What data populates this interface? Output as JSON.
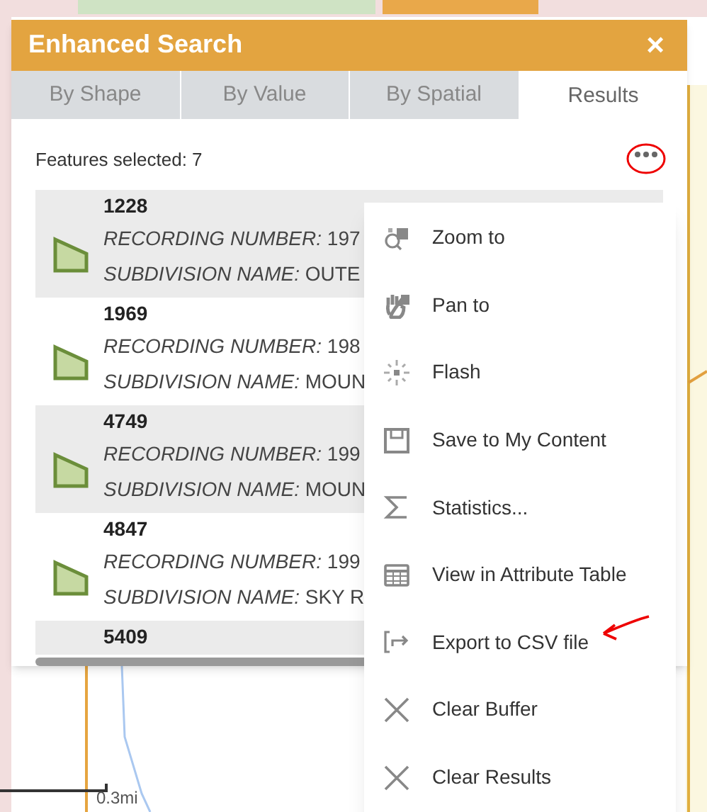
{
  "window": {
    "title": "Enhanced Search",
    "close": "×"
  },
  "tabs": [
    {
      "label": "By Shape",
      "selected": false
    },
    {
      "label": "By Value",
      "selected": false
    },
    {
      "label": "By Spatial",
      "selected": false
    },
    {
      "label": "Results",
      "selected": true
    }
  ],
  "summary": "Features selected: 7",
  "results": [
    {
      "title": "1228",
      "recording": "*RECORDING NUMBER:* 197",
      "subdivision": "*SUBDIVISION NAME:* OUTE"
    },
    {
      "title": "1969",
      "recording": "*RECORDING NUMBER:* 198",
      "subdivision": "*SUBDIVISION NAME:* MOUN"
    },
    {
      "title": "4749",
      "recording": "*RECORDING NUMBER:* 199",
      "subdivision": "*SUBDIVISION NAME:* MOUN"
    },
    {
      "title": "4847",
      "recording": "*RECORDING NUMBER:* 199",
      "subdivision": "*SUBDIVISION NAME:* SKY R"
    },
    {
      "title": "5409"
    }
  ],
  "menu": [
    {
      "label": "Zoom to",
      "kind": "zoom"
    },
    {
      "label": "Pan to",
      "kind": "pan"
    },
    {
      "label": "Flash",
      "kind": "flash"
    },
    {
      "label": "Save to My Content",
      "kind": "save"
    },
    {
      "label": "Statistics...",
      "kind": "sigma"
    },
    {
      "label": "View in Attribute Table",
      "kind": "table"
    },
    {
      "label": "Export to CSV file",
      "kind": "export"
    },
    {
      "label": "Clear Buffer",
      "kind": "clear"
    },
    {
      "label": "Clear Results",
      "kind": "clear"
    }
  ],
  "scale": "0.3mi"
}
